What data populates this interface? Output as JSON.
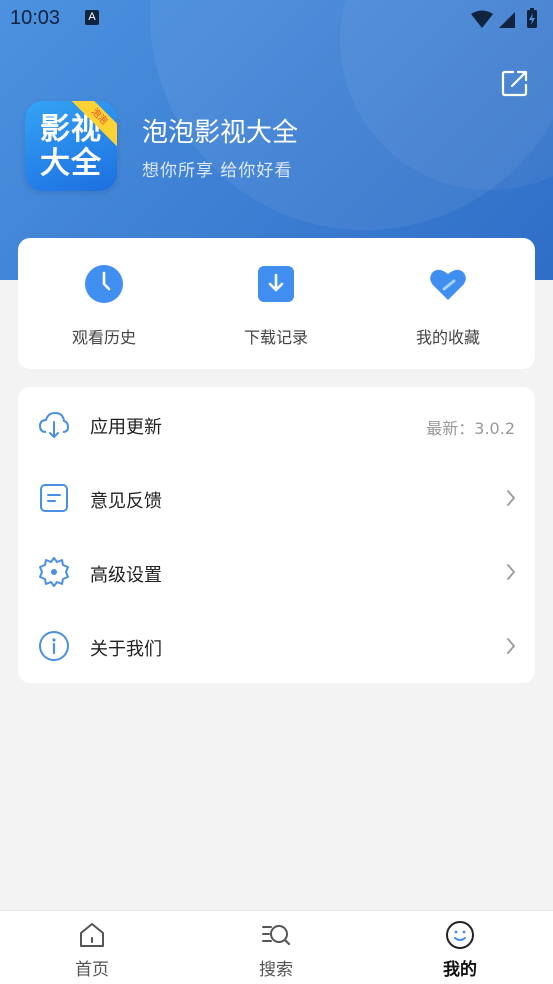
{
  "status_bar": {
    "time": "10:03",
    "sim_badge": "A"
  },
  "header": {
    "app_name": "泡泡影视大全",
    "slogan": "想你所享  给你好看",
    "logo_text": "影视大全",
    "logo_ribbon": "泡泡",
    "background_colors": [
      "#4c92e0",
      "#2f6ec7"
    ]
  },
  "quick_actions": [
    {
      "label": "观看历史",
      "icon": "clock-icon"
    },
    {
      "label": "下载记录",
      "icon": "download-icon"
    },
    {
      "label": "我的收藏",
      "icon": "heart-icon"
    }
  ],
  "menu": {
    "update": {
      "label": "应用更新",
      "value": "最新：3.0.2",
      "icon": "cloud-download-icon"
    },
    "feedback": {
      "label": "意见反馈",
      "icon": "feedback-icon"
    },
    "settings": {
      "label": "高级设置",
      "icon": "gear-icon"
    },
    "about": {
      "label": "关于我们",
      "icon": "info-icon"
    }
  },
  "bottom_nav": [
    {
      "label": "首页",
      "icon": "home-icon"
    },
    {
      "label": "搜索",
      "icon": "search-icon"
    },
    {
      "label": "我的",
      "icon": "smile-icon",
      "active": true
    }
  ],
  "accent_color": "#4a90e2"
}
